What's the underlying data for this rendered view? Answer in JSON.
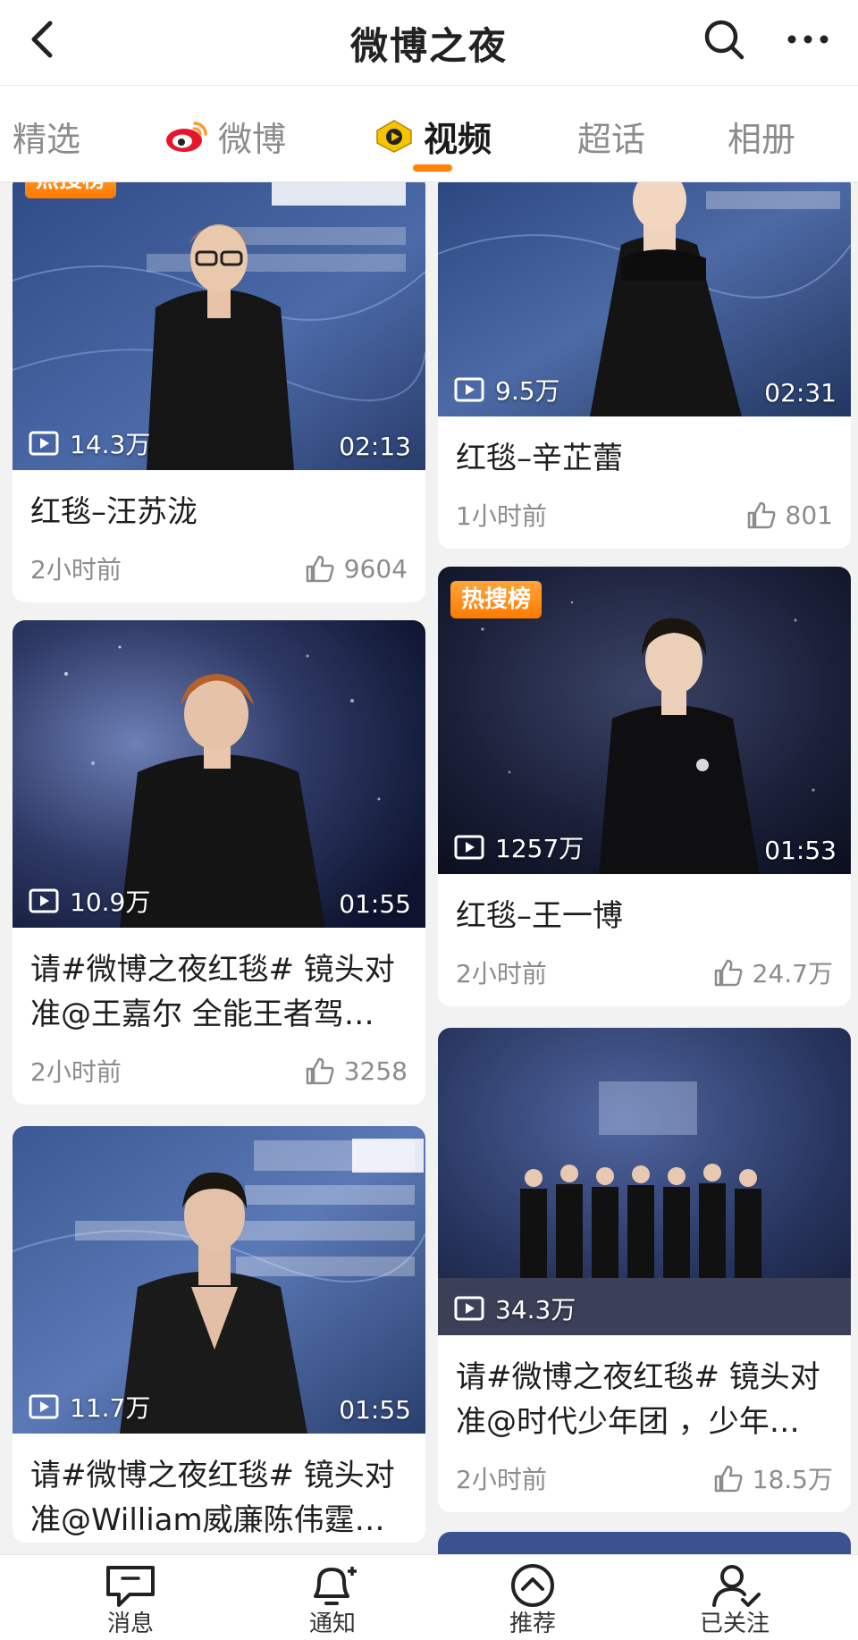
{
  "header": {
    "title": "微博之夜",
    "back_icon": "back-arrow-icon",
    "search_icon": "search-icon",
    "more_icon": "more-icon"
  },
  "tabs": [
    {
      "label": "精选",
      "active": false
    },
    {
      "label": "微博",
      "active": false,
      "icon": "weibo-logo-icon"
    },
    {
      "label": "视频",
      "active": true,
      "icon": "video-tab-icon"
    },
    {
      "label": "超话",
      "active": false
    },
    {
      "label": "相册",
      "active": false
    }
  ],
  "accent_color": "#ff8200",
  "cards": [
    {
      "id": "c1",
      "column": "left",
      "badge": "热搜榜",
      "plays": "14.3万",
      "duration": "02:13",
      "title": "红毯–汪苏泷",
      "time": "2小时前",
      "likes": "9604"
    },
    {
      "id": "c2",
      "column": "right",
      "badge": "",
      "plays": "9.5万",
      "duration": "02:31",
      "title": "红毯–辛芷蕾",
      "time": "1小时前",
      "likes": "801"
    },
    {
      "id": "c3",
      "column": "left",
      "badge": "",
      "plays": "10.9万",
      "duration": "01:55",
      "title": "请#微博之夜红毯# 镜头对准@王嘉尔 全能王者驾…",
      "time": "2小时前",
      "likes": "3258"
    },
    {
      "id": "c4",
      "column": "right",
      "badge": "热搜榜",
      "plays": "1257万",
      "duration": "01:53",
      "title": "红毯–王一博",
      "time": "2小时前",
      "likes": "24.7万"
    },
    {
      "id": "c5",
      "column": "left",
      "badge": "",
      "plays": "11.7万",
      "duration": "01:55",
      "title": "请#微博之夜红毯# 镜头对准@William威廉陈伟霆…",
      "time": "",
      "likes": ""
    },
    {
      "id": "c6",
      "column": "right",
      "badge": "",
      "plays": "34.3万",
      "duration": "",
      "title": "请#微博之夜红毯# 镜头对准@时代少年团 ，少年…",
      "time": "2小时前",
      "likes": "18.5万"
    }
  ],
  "bottom_nav": [
    {
      "label": "消息",
      "icon": "message-icon"
    },
    {
      "label": "通知",
      "icon": "notification-bell-icon"
    },
    {
      "label": "推荐",
      "icon": "recommend-icon"
    },
    {
      "label": "已关注",
      "icon": "following-user-icon"
    }
  ]
}
